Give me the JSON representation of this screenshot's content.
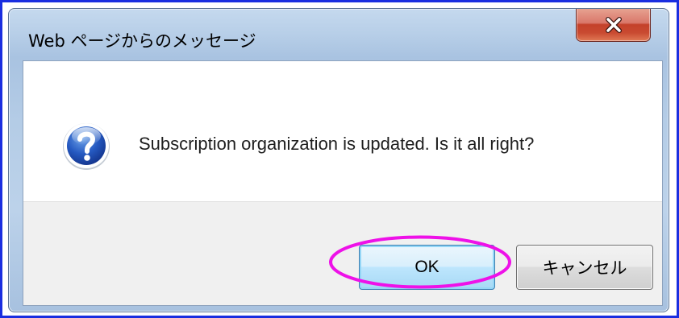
{
  "window": {
    "title": "Web ページからのメッセージ",
    "close_icon": "close-x-icon"
  },
  "dialog": {
    "icon": "question-icon",
    "message": "Subscription organization is updated. Is it all right?"
  },
  "buttons": {
    "ok_label": "OK",
    "cancel_label": "キャンセル"
  },
  "annotation": {
    "shape": "ellipse",
    "color": "#ee11e8",
    "target": "ok-button"
  },
  "colors": {
    "screen_border": "#1a2ee0",
    "close_button": "#c94a31",
    "ok_button_border": "#3c7fb1",
    "button_area_background": "#f0f0f0"
  }
}
